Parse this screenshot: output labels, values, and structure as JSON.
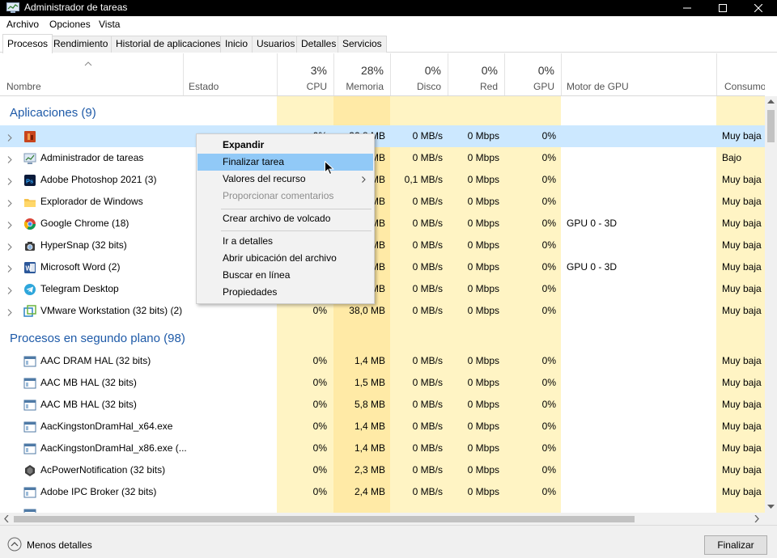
{
  "window": {
    "title": "Administrador de tareas"
  },
  "menu": [
    "Archivo",
    "Opciones",
    "Vista"
  ],
  "tabs": [
    "Procesos",
    "Rendimiento",
    "Historial de aplicaciones",
    "Inicio",
    "Usuarios",
    "Detalles",
    "Servicios"
  ],
  "active_tab": "Procesos",
  "columns": {
    "name": "Nombre",
    "status": "Estado",
    "cpu": {
      "pct": "3%",
      "label": "CPU"
    },
    "memory": {
      "pct": "28%",
      "label": "Memoria"
    },
    "disk": {
      "pct": "0%",
      "label": "Disco"
    },
    "network": {
      "pct": "0%",
      "label": "Red"
    },
    "gpu": {
      "pct": "0%",
      "label": "GPU"
    },
    "gpu_engine": "Motor de GPU",
    "power": "Consumo de"
  },
  "groups": {
    "apps": "Aplicaciones (9)",
    "background": "Procesos en segundo plano (98)"
  },
  "apps": [
    {
      "name": "",
      "cpu": "0%",
      "mem": "32,8 MB",
      "disk": "0 MB/s",
      "net": "0 Mbps",
      "gpu": "0%",
      "engine": "",
      "power": "Muy baja",
      "icon": "app-red-icon"
    },
    {
      "name": "Administrador de tareas",
      "cpu": "",
      "mem": "MB",
      "disk": "0 MB/s",
      "net": "0 Mbps",
      "gpu": "0%",
      "engine": "",
      "power": "Bajo",
      "icon": "task-manager-icon"
    },
    {
      "name": "Adobe Photoshop 2021 (3)",
      "cpu": "",
      "mem": "MB",
      "disk": "0,1 MB/s",
      "net": "0 Mbps",
      "gpu": "0%",
      "engine": "",
      "power": "Muy baja",
      "icon": "photoshop-icon"
    },
    {
      "name": "Explorador de Windows",
      "cpu": "",
      "mem": "MB",
      "disk": "0 MB/s",
      "net": "0 Mbps",
      "gpu": "0%",
      "engine": "",
      "power": "Muy baja",
      "icon": "folder-icon"
    },
    {
      "name": "Google Chrome (18)",
      "cpu": "",
      "mem": "MB",
      "disk": "0 MB/s",
      "net": "0 Mbps",
      "gpu": "0%",
      "engine": "GPU 0 - 3D",
      "power": "Muy baja",
      "icon": "chrome-icon"
    },
    {
      "name": "HyperSnap (32 bits)",
      "cpu": "",
      "mem": "MB",
      "disk": "0 MB/s",
      "net": "0 Mbps",
      "gpu": "0%",
      "engine": "",
      "power": "Muy baja",
      "icon": "hypersnap-icon"
    },
    {
      "name": "Microsoft Word (2)",
      "cpu": "",
      "mem": "MB",
      "disk": "0 MB/s",
      "net": "0 Mbps",
      "gpu": "0%",
      "engine": "GPU 0 - 3D",
      "power": "Muy baja",
      "icon": "word-icon"
    },
    {
      "name": "Telegram Desktop",
      "cpu": "",
      "mem": "MB",
      "disk": "0 MB/s",
      "net": "0 Mbps",
      "gpu": "0%",
      "engine": "",
      "power": "Muy baja",
      "icon": "telegram-icon"
    },
    {
      "name": "VMware Workstation (32 bits) (2)",
      "cpu": "0%",
      "mem": "38,0 MB",
      "disk": "0 MB/s",
      "net": "0 Mbps",
      "gpu": "0%",
      "engine": "",
      "power": "Muy baja",
      "icon": "vmware-icon"
    }
  ],
  "background": [
    {
      "name": "AAC DRAM HAL (32 bits)",
      "cpu": "0%",
      "mem": "1,4 MB",
      "disk": "0 MB/s",
      "net": "0 Mbps",
      "gpu": "0%",
      "power": "Muy baja",
      "icon": "service-window-icon"
    },
    {
      "name": "AAC MB HAL (32 bits)",
      "cpu": "0%",
      "mem": "1,5 MB",
      "disk": "0 MB/s",
      "net": "0 Mbps",
      "gpu": "0%",
      "power": "Muy baja",
      "icon": "service-window-icon"
    },
    {
      "name": "AAC MB HAL (32 bits)",
      "cpu": "0%",
      "mem": "5,8 MB",
      "disk": "0 MB/s",
      "net": "0 Mbps",
      "gpu": "0%",
      "power": "Muy baja",
      "icon": "service-window-icon"
    },
    {
      "name": "AacKingstonDramHal_x64.exe",
      "cpu": "0%",
      "mem": "1,4 MB",
      "disk": "0 MB/s",
      "net": "0 Mbps",
      "gpu": "0%",
      "power": "Muy baja",
      "icon": "service-window-icon"
    },
    {
      "name": "AacKingstonDramHal_x86.exe (...",
      "cpu": "0%",
      "mem": "1,4 MB",
      "disk": "0 MB/s",
      "net": "0 Mbps",
      "gpu": "0%",
      "power": "Muy baja",
      "icon": "service-window-icon"
    },
    {
      "name": "AcPowerNotification (32 bits)",
      "cpu": "0%",
      "mem": "2,3 MB",
      "disk": "0 MB/s",
      "net": "0 Mbps",
      "gpu": "0%",
      "power": "Muy baja",
      "icon": "power-notification-icon"
    },
    {
      "name": "Adobe IPC Broker (32 bits)",
      "cpu": "0%",
      "mem": "2,4 MB",
      "disk": "0 MB/s",
      "net": "0 Mbps",
      "gpu": "0%",
      "power": "Muy baja",
      "icon": "service-window-icon"
    }
  ],
  "context_menu": {
    "expand": "Expandir",
    "end_task": "Finalizar tarea",
    "resource_values": "Valores del recurso",
    "feedback": "Proporcionar comentarios",
    "dump": "Crear archivo de volcado",
    "details": "Ir a detalles",
    "open_location": "Abrir ubicación del archivo",
    "search_online": "Buscar en línea",
    "properties": "Propiedades"
  },
  "footer": {
    "less_details": "Menos detalles",
    "end_task": "Finalizar tarea"
  },
  "colors": {
    "selected_row": "#cce8ff",
    "menu_hover": "#91c9f7",
    "group_title": "#1e5aa8",
    "heat_light": "#fff4c4",
    "heat_medium": "#ffeaa6"
  }
}
